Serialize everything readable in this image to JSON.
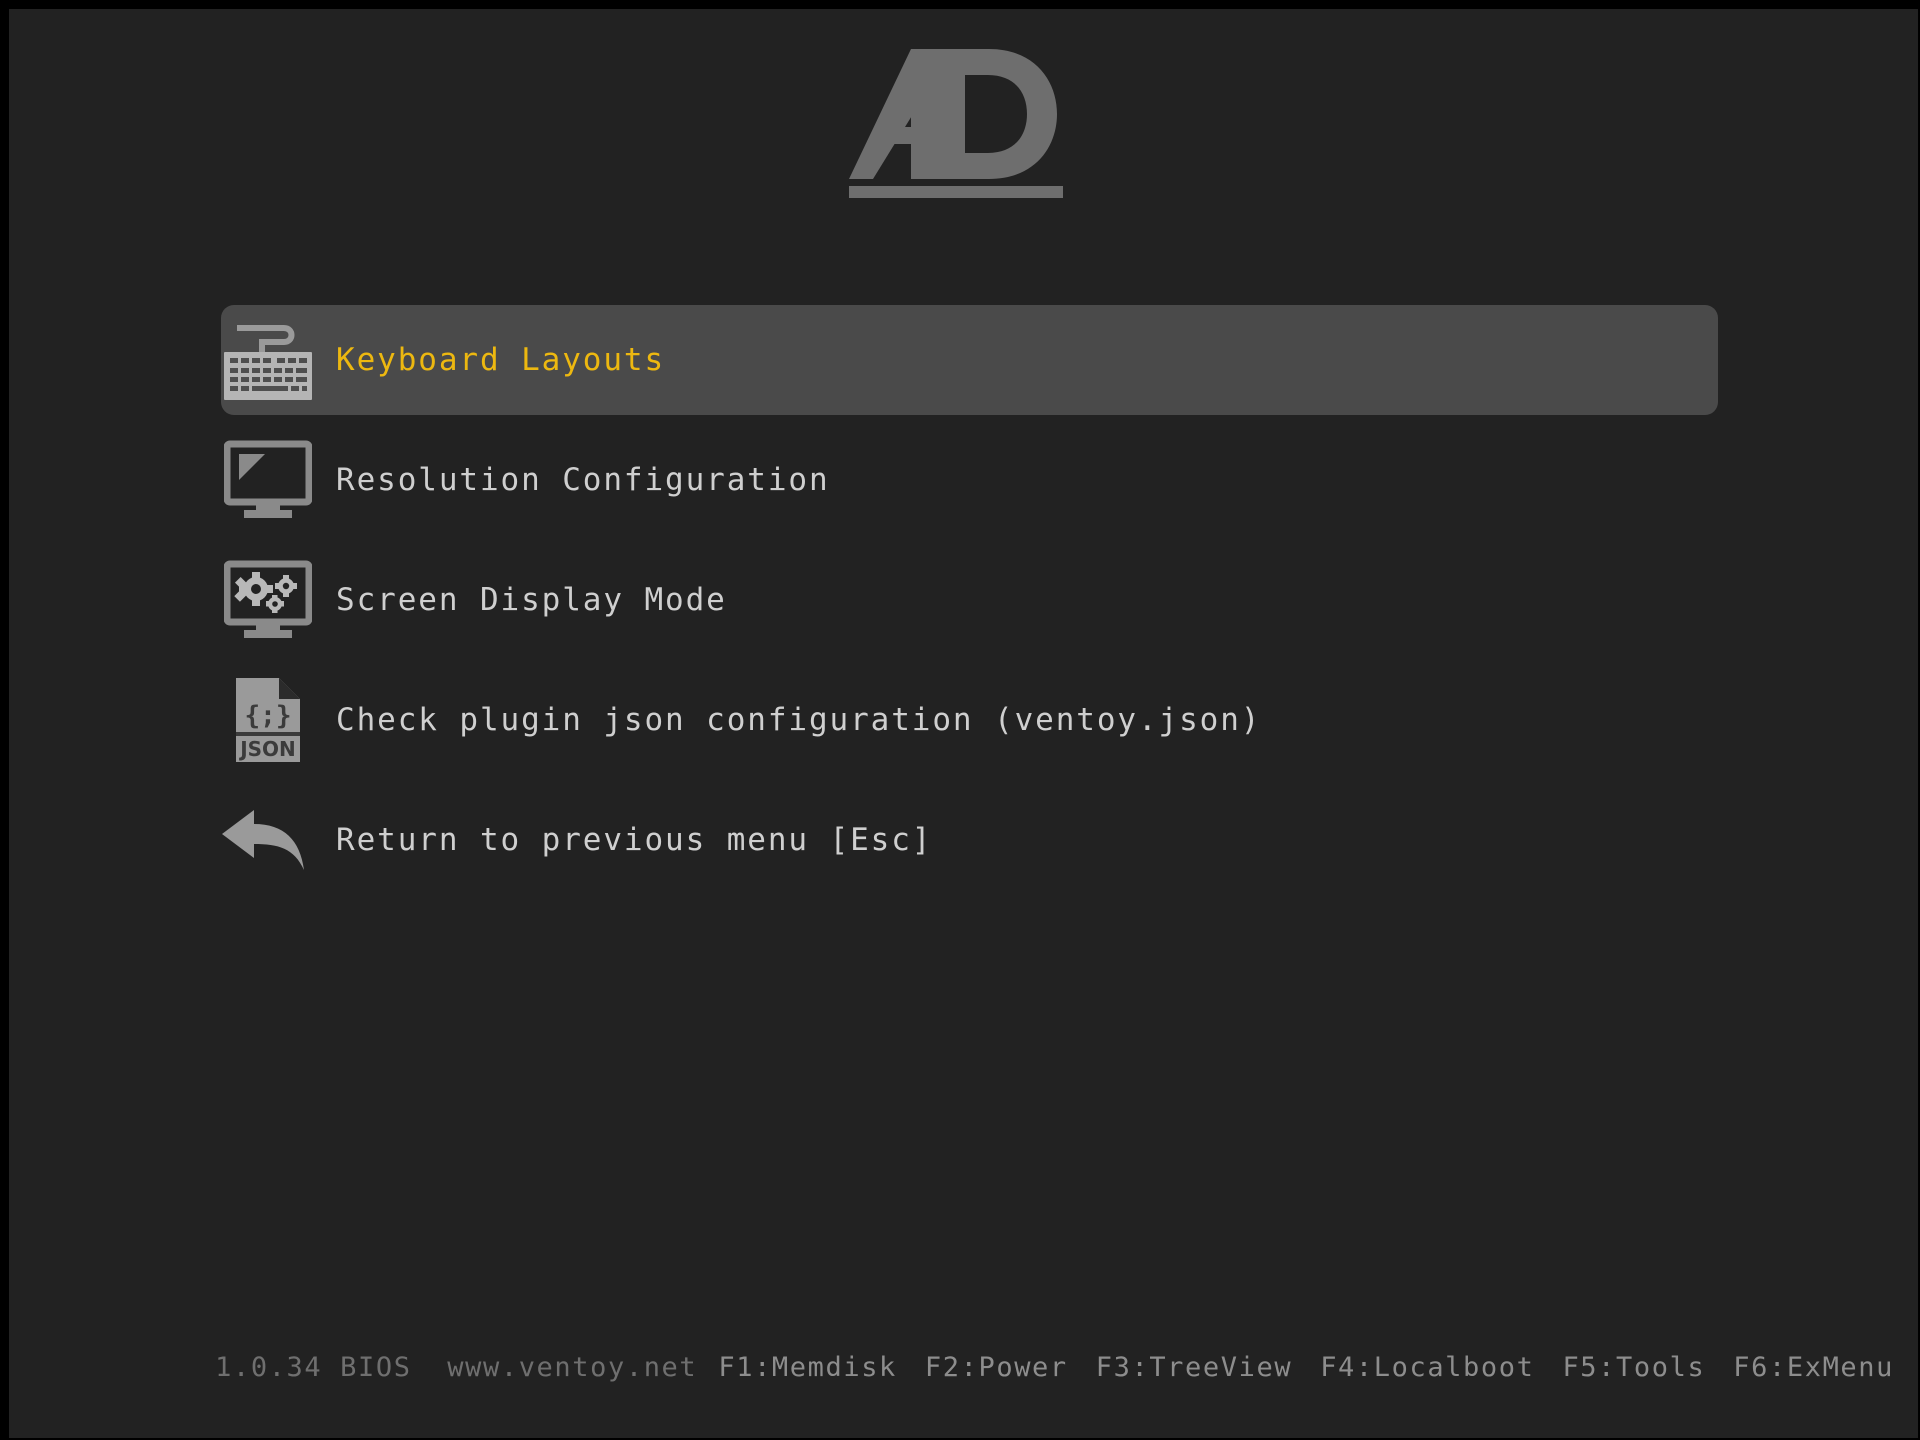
{
  "screen": {
    "background_color": "#222222",
    "accent_color": "#edb810",
    "text_color": "#cfcfcf",
    "icon_color": "#8a8a8a",
    "selection_color": "#4a4a4a"
  },
  "logo": {
    "name": "ventoy-ad-logo",
    "text": "AD"
  },
  "menu": {
    "items": [
      {
        "label": "Keyboard Layouts",
        "icon": "keyboard-icon",
        "selected": true
      },
      {
        "label": "Resolution Configuration",
        "icon": "monitor-icon",
        "selected": false
      },
      {
        "label": "Screen Display Mode",
        "icon": "monitor-gears-icon",
        "selected": false
      },
      {
        "label": "Check plugin json configuration (ventoy.json)",
        "icon": "json-file-icon",
        "selected": false
      },
      {
        "label": "Return to previous menu [Esc]",
        "icon": "back-arrow-icon",
        "selected": false
      }
    ]
  },
  "json_icon": {
    "braces": "{;}",
    "label": "JSON"
  },
  "statusbar": {
    "version": "1.0.34 BIOS",
    "website": "www.ventoy.net",
    "function_keys": [
      "F1:Memdisk",
      "F2:Power",
      "F3:TreeView",
      "F4:Localboot",
      "F5:Tools",
      "F6:ExMenu"
    ]
  }
}
